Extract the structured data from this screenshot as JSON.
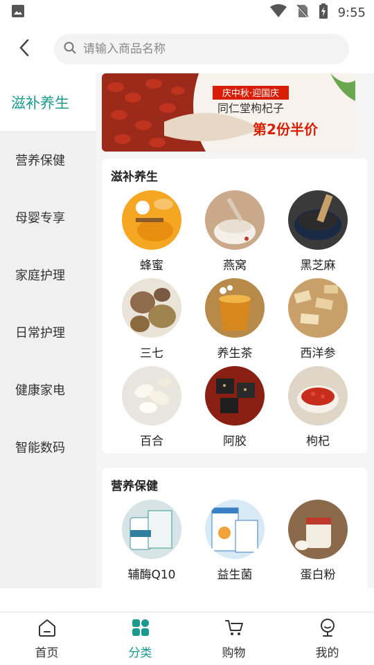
{
  "status_bar": {
    "time": "9:55"
  },
  "search": {
    "placeholder": "请输入商品名称"
  },
  "sidebar": {
    "items": [
      {
        "label": "滋补养生",
        "active": true
      },
      {
        "label": "营养保健"
      },
      {
        "label": "母婴专享"
      },
      {
        "label": "家庭护理"
      },
      {
        "label": "日常护理"
      },
      {
        "label": "健康家电"
      },
      {
        "label": "智能数码"
      }
    ]
  },
  "banner": {
    "line1": "庆中秋·迎国庆",
    "line2": "同仁堂枸杞子",
    "line3": "第2份半价"
  },
  "sections": [
    {
      "title": "滋补养生",
      "items": [
        {
          "label": "蜂蜜"
        },
        {
          "label": "燕窝"
        },
        {
          "label": "黑芝麻"
        },
        {
          "label": "三七"
        },
        {
          "label": "养生茶"
        },
        {
          "label": "西洋参"
        },
        {
          "label": "百合"
        },
        {
          "label": "阿胶"
        },
        {
          "label": "枸杞"
        }
      ]
    },
    {
      "title": "营养保健",
      "items": [
        {
          "label": "辅酶Q10"
        },
        {
          "label": "益生菌"
        },
        {
          "label": "蛋白粉"
        }
      ]
    }
  ],
  "tabbar": {
    "tabs": [
      {
        "label": "首页"
      },
      {
        "label": "分类",
        "active": true
      },
      {
        "label": "购物"
      },
      {
        "label": "我的"
      }
    ]
  },
  "colors": {
    "accent": "#1a9a8f",
    "banner_red": "#d81e06"
  }
}
